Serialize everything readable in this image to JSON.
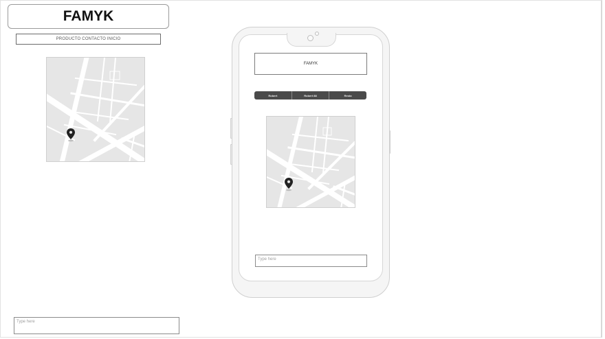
{
  "header": {
    "title": "FAMYK",
    "nav_text": "PRODUCTO CONTACTO INICIO"
  },
  "left": {
    "input_placeholder": "Type here"
  },
  "mobile": {
    "title": "FAMYK",
    "tabs": [
      {
        "label": "Robert"
      },
      {
        "label": "Robert 88"
      },
      {
        "label": "Resto"
      }
    ],
    "input_placeholder": "Type here"
  },
  "colors": {
    "map_bg": "#e6e6e6",
    "road": "#ffffff",
    "pin": "#222222",
    "tab_bg": "#4a4a4a"
  },
  "icons": {
    "map_marker": "map-marker-icon"
  }
}
